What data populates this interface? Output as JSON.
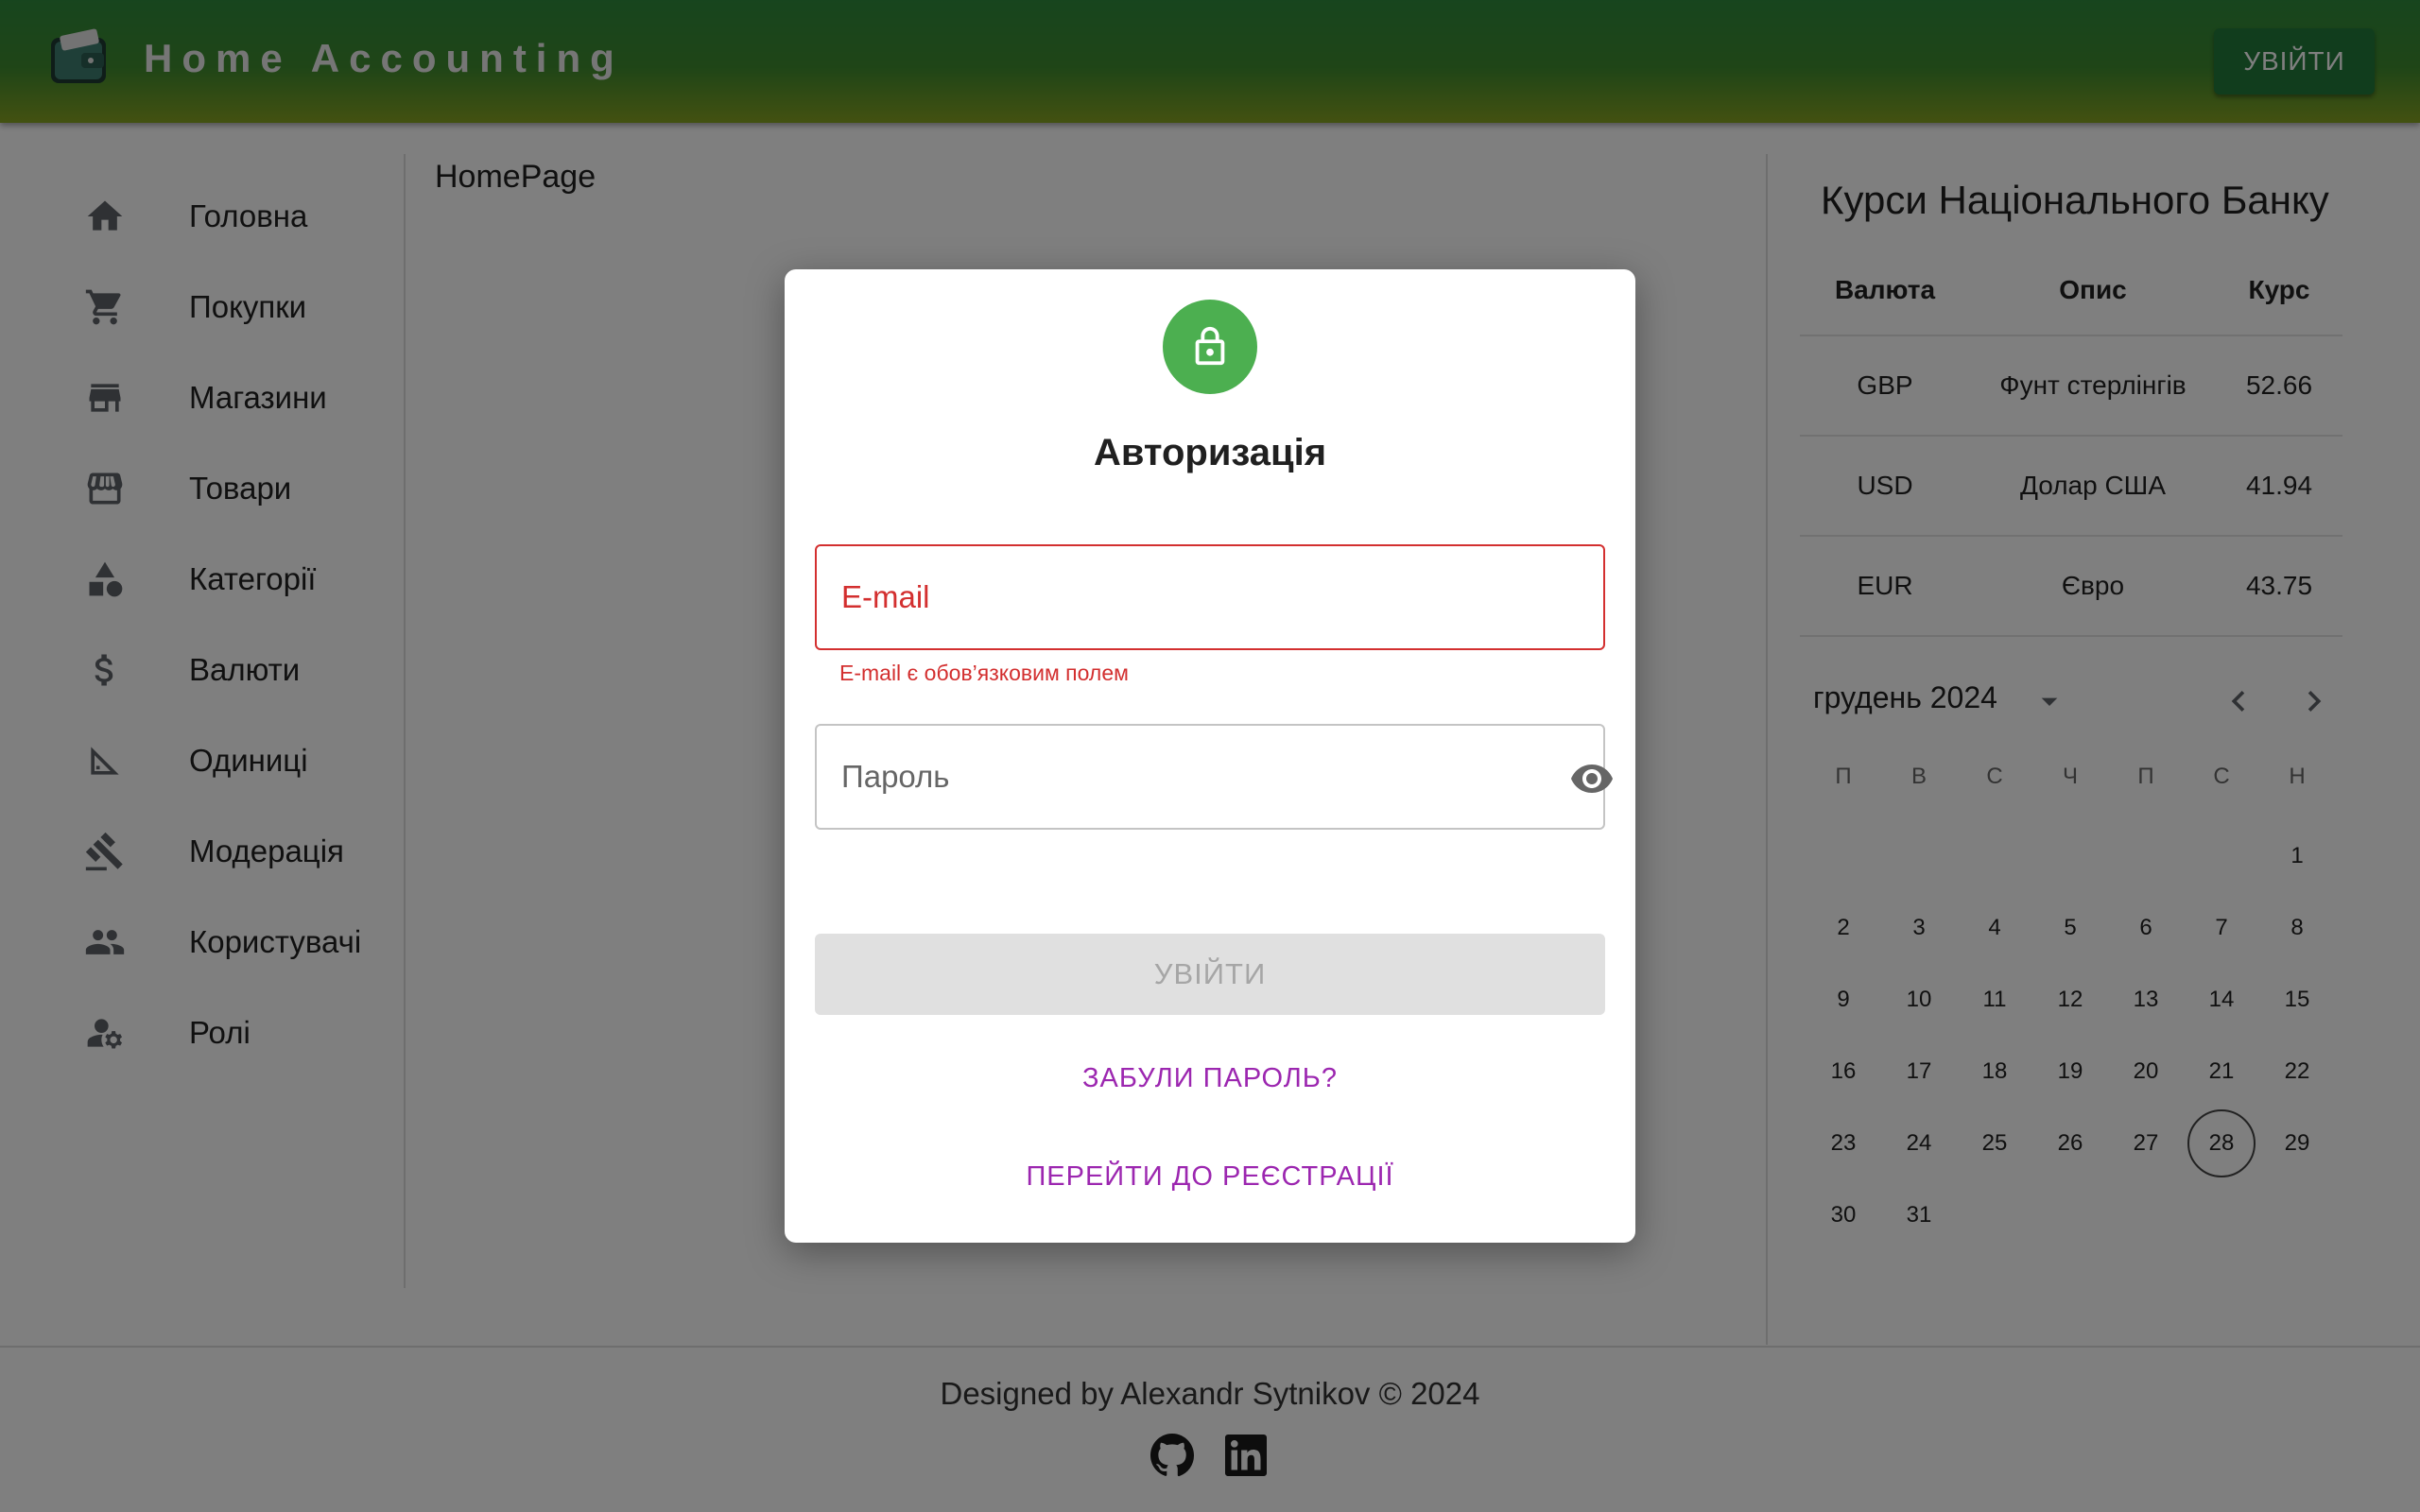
{
  "header": {
    "title": "Home Accounting",
    "login_label": "УВІЙТИ"
  },
  "sidebar": {
    "items": [
      {
        "label": "Головна",
        "icon": "home-icon"
      },
      {
        "label": "Покупки",
        "icon": "cart-icon"
      },
      {
        "label": "Магазини",
        "icon": "store-icon"
      },
      {
        "label": "Товари",
        "icon": "storefront-icon"
      },
      {
        "label": "Категорії",
        "icon": "category-icon"
      },
      {
        "label": "Валюти",
        "icon": "dollar-icon"
      },
      {
        "label": "Одиниці",
        "icon": "ruler-icon"
      },
      {
        "label": "Модерація",
        "icon": "gavel-icon"
      },
      {
        "label": "Користувачі",
        "icon": "people-icon"
      },
      {
        "label": "Ролі",
        "icon": "manage-accounts-icon"
      }
    ]
  },
  "main": {
    "title": "HomePage"
  },
  "rates": {
    "title": "Курси Національного Банку",
    "headers": [
      "Валюта",
      "Опис",
      "Курс"
    ],
    "rows": [
      {
        "code": "GBP",
        "desc": "Фунт стерлінгів",
        "rate": "52.66"
      },
      {
        "code": "USD",
        "desc": "Долар США",
        "rate": "41.94"
      },
      {
        "code": "EUR",
        "desc": "Євро",
        "rate": "43.75"
      }
    ]
  },
  "calendar": {
    "month_label": "грудень 2024",
    "weekdays": [
      "П",
      "В",
      "С",
      "Ч",
      "П",
      "С",
      "Н"
    ],
    "first_weekday_index": 6,
    "days_in_month": 31,
    "selected_day": 28
  },
  "footer": {
    "text": "Designed by Alexandr Sytnikov © 2024"
  },
  "dialog": {
    "title": "Авторизація",
    "email_placeholder": "E-mail",
    "email_error": "E-mail є обов’язковим полем",
    "password_placeholder": "Пароль",
    "submit_label": "УВІЙТИ",
    "forgot_label": "ЗАБУЛИ ПАРОЛЬ?",
    "register_label": "ПЕРЕЙТИ ДО РЕЄСТРАЦІЇ"
  },
  "colors": {
    "accent_green": "#4caf50",
    "error_red": "#d32f2f",
    "link_purple": "#9c27b0"
  }
}
